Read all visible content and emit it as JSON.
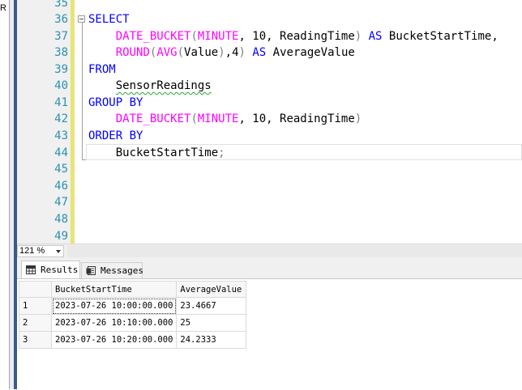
{
  "left_panel": {
    "fragment_text": "R"
  },
  "editor": {
    "lines": [
      {
        "number": "35"
      },
      {
        "number": "36"
      },
      {
        "number": "37"
      },
      {
        "number": "38"
      },
      {
        "number": "39"
      },
      {
        "number": "40"
      },
      {
        "number": "41"
      },
      {
        "number": "42"
      },
      {
        "number": "43"
      },
      {
        "number": "44"
      },
      {
        "number": "45"
      },
      {
        "number": "46"
      },
      {
        "number": "47"
      },
      {
        "number": "48"
      },
      {
        "number": "49"
      }
    ],
    "code": {
      "l36_select": "SELECT",
      "l37_fn": "DATE_BUCKET",
      "l37_open": "(",
      "l37_arg1": "MINUTE",
      "l37_rest": ", 10, ReadingTime",
      "l37_close": ")",
      "l37_as": "AS",
      "l37_alias": "BucketStartTime,",
      "l38_fn1": "ROUND",
      "l38_open1": "(",
      "l38_fn2": "AVG",
      "l38_open2": "(",
      "l38_arg": "Value",
      "l38_close2": ")",
      "l38_comma4": ",4",
      "l38_close1": ")",
      "l38_as": "AS",
      "l38_alias": "AverageValue",
      "l39_from": "FROM",
      "l40_table": "SensorReadings",
      "l41_group": "GROUP BY",
      "l42_fn": "DATE_BUCKET",
      "l42_open": "(",
      "l42_arg1": "MINUTE",
      "l42_rest": ", 10, ReadingTime",
      "l42_close": ")",
      "l43_order": "ORDER BY",
      "l44_col": "BucketStartTime",
      "l44_semi": ";"
    },
    "colors": {
      "keyword": "#0000ff",
      "function": "#ff00ff",
      "operator": "#808080",
      "line_number": "#2b91af"
    }
  },
  "zoom": {
    "value": "121 %"
  },
  "results_tabs": [
    {
      "label": "Results",
      "icon": "grid-icon"
    },
    {
      "label": "Messages",
      "icon": "messages-icon"
    }
  ],
  "grid": {
    "columns": [
      "BucketStartTime",
      "AverageValue"
    ],
    "rows": [
      {
        "rownum": "1",
        "BucketStartTime": "2023-07-26 10:00:00.000",
        "AverageValue": "23.4667"
      },
      {
        "rownum": "2",
        "BucketStartTime": "2023-07-26 10:10:00.000",
        "AverageValue": "25"
      },
      {
        "rownum": "3",
        "BucketStartTime": "2023-07-26 10:20:00.000",
        "AverageValue": "24.2333"
      }
    ]
  }
}
